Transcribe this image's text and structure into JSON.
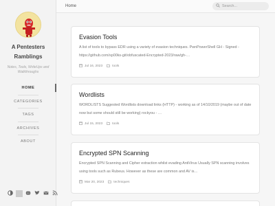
{
  "sidebar": {
    "title": "A Pentesters Ramblings",
    "subtitle": "Notes, Tools, WriteUps and Walkthroughs",
    "nav": [
      {
        "label": "HOME"
      },
      {
        "label": "CATEGORIES"
      },
      {
        "label": "TAGS"
      },
      {
        "label": "ARCHIVES"
      },
      {
        "label": "ABOUT"
      }
    ],
    "social_icons": [
      "theme-toggle-icon",
      "github-icon",
      "twitter-icon",
      "email-icon",
      "rss-icon"
    ]
  },
  "topbar": {
    "breadcrumb": "Home",
    "search_placeholder": "Search..."
  },
  "posts": [
    {
      "title": "Evasion Tools",
      "excerpt": "A list of tools to bypass EDR using a variety of evasion techniques. PwnPowerShell GH - Signed - https://github.com/sp00ks-git/obfuscated-Encrypted-2023/raw/gh-…",
      "date": "Jul 16, 2023",
      "tag": "tools"
    },
    {
      "title": "Wordlists",
      "excerpt": "WORDLISTS Suggested Wordlists download links (HTTP) - working as of 14/10/2019 (maybe out of date now but some should still be working) rockyou - …",
      "date": "Jul 15, 2023",
      "tag": "tools"
    },
    {
      "title": "Encrypted SPN Scanning",
      "excerpt": "Encrypted SPN Scanning and Cipher extraction whilst evading AntiVirus Usually SPN scanning involves using tools such as Rubeus. However as these are common and AV is…",
      "date": "Mar 20, 2023",
      "tag": "techniques"
    }
  ]
}
